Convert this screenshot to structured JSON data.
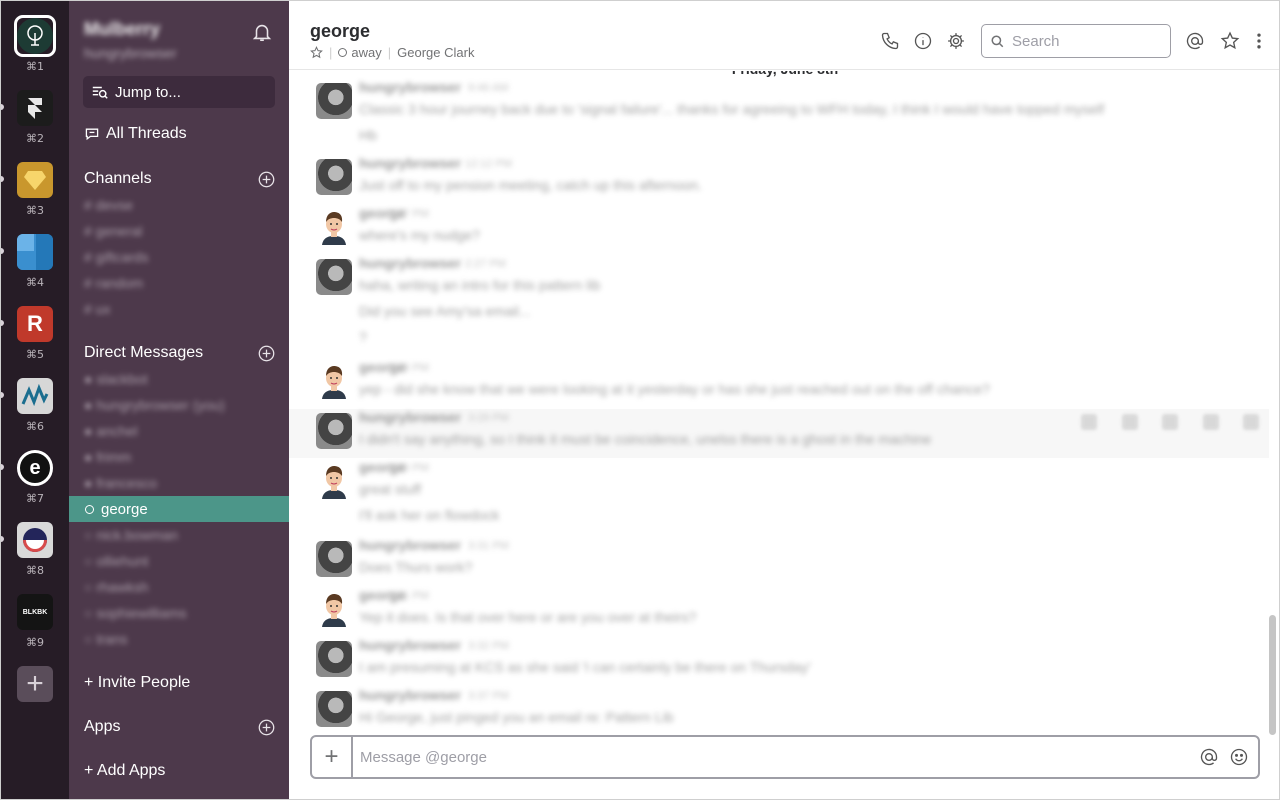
{
  "workspaces": [
    {
      "key": "⌘1",
      "icon": "mulberry-logo-icon",
      "color": "#1d3b34",
      "active": true
    },
    {
      "key": "⌘2",
      "icon": "framer-logo-icon",
      "color": "#1c1c1c"
    },
    {
      "key": "⌘3",
      "icon": "sketch-diamond-icon",
      "color": "#c9972d"
    },
    {
      "key": "⌘4",
      "icon": "blue-squares-icon",
      "color": "#3a8fcf"
    },
    {
      "key": "⌘5",
      "icon": "r-logo-icon",
      "color": "#c0392b",
      "letter": "R"
    },
    {
      "key": "⌘6",
      "icon": "zigzag-logo-icon",
      "color": "#d7d7d7"
    },
    {
      "key": "⌘7",
      "icon": "e-logo-icon",
      "color": "#111111",
      "letter": "e"
    },
    {
      "key": "⌘8",
      "icon": "half-circle-logo-icon",
      "color": "#d9d9d9"
    },
    {
      "key": "⌘9",
      "icon": "blkbk-logo-icon",
      "color": "#141414",
      "letter": "BLKBK"
    }
  ],
  "sidebar": {
    "team_name": "Mulberry",
    "team_user": "hungrybrowser",
    "jump_label": "Jump to...",
    "threads_label": "All Threads",
    "channels_label": "Channels",
    "channels": [
      "devse",
      "general",
      "giftcards",
      "random",
      "ux"
    ],
    "dm_label": "Direct Messages",
    "dms": [
      "slackbot",
      "hungrybrowser (you)",
      "anchel",
      "frimm",
      "francesco"
    ],
    "selected_dm": "george",
    "dms_after": [
      "nick.bowman",
      "olliehunt",
      "rhawksh",
      "sophiewilliams",
      "trans"
    ],
    "invite_label": "+ Invite People",
    "apps_label": "Apps",
    "add_apps_label": "+ Add Apps"
  },
  "header": {
    "title": "george",
    "status": "away",
    "full_name": "George Clark",
    "search_placeholder": "Search"
  },
  "date_divider": "Friday, June 8th",
  "messages": [
    {
      "author": "hungrybrowser",
      "time": "9:46 AM",
      "avatar": "h",
      "lines": [
        "Classic 3 hour journey back due to 'signal failure'... thanks for agreeing to WFH today, I think I would have topped myself",
        "Hb"
      ]
    },
    {
      "author": "hungrybrowser",
      "time": "12:12 PM",
      "avatar": "h",
      "lines": [
        "Just off to my pension meeting, catch up this afternoon."
      ]
    },
    {
      "author": "george",
      "time": "2:27 PM",
      "avatar": "g",
      "lines": [
        "where's my nudge?"
      ]
    },
    {
      "author": "hungrybrowser",
      "time": "2:27 PM",
      "avatar": "h",
      "lines": [
        "haha, writing an intro for this pattern lib",
        "Did you see Amy'sa email...",
        "?"
      ]
    },
    {
      "author": "george",
      "time": "3:28 PM",
      "avatar": "g",
      "lines": [
        "yep - did she know that we were looking at it yesterday or has she just reached out on the off chance?"
      ]
    },
    {
      "author": "hungrybrowser",
      "time": "3:29 PM",
      "avatar": "h",
      "lines": [
        "I didn't say anything, so I think it must be coincidence, unelss there is a ghost in the machine"
      ]
    },
    {
      "author": "george",
      "time": "3:30 PM",
      "avatar": "g",
      "lines": [
        "great stuff",
        "I'll ask her on flowdock"
      ]
    },
    {
      "author": "hungrybrowser",
      "time": "3:31 PM",
      "avatar": "h",
      "lines": [
        "Does Thurs work?"
      ]
    },
    {
      "author": "george",
      "time": "3:31 PM",
      "avatar": "g",
      "lines": [
        "Yep it does. Is that over here or are you over at theirs?"
      ]
    },
    {
      "author": "hungrybrowser",
      "time": "3:32 PM",
      "avatar": "h",
      "lines": [
        "I am presuming at KCS as she said 'I can certainly be there on Thursday'"
      ]
    },
    {
      "author": "hungrybrowser",
      "time": "3:37 PM",
      "avatar": "h",
      "lines": [
        "Hi George, just pinged you an email re: Pattern Lib"
      ]
    }
  ],
  "composer": {
    "placeholder": "Message @george"
  }
}
